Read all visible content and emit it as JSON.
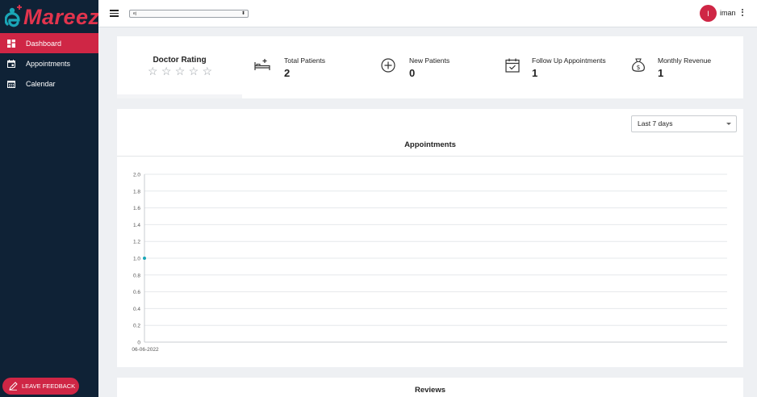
{
  "brand": {
    "name": "Mareez",
    "accent": "#cf2645",
    "sidebar_bg": "#0f2236"
  },
  "sidebar": {
    "items": [
      {
        "label": "Dashboard",
        "icon": "dashboard-icon",
        "active": true
      },
      {
        "label": "Appointments",
        "icon": "calendar-event-icon",
        "active": false
      },
      {
        "label": "Calendar",
        "icon": "calendar-grid-icon",
        "active": false
      }
    ],
    "feedback_label": "LEAVE FEEDBACK"
  },
  "topbar": {
    "clinic_value": "ej",
    "user_initial": "I",
    "user_name": "iman"
  },
  "stats": {
    "rating_title": "Doctor Rating",
    "stars": [
      "☆",
      "☆",
      "☆",
      "☆",
      "☆"
    ],
    "total_patients": {
      "label": "Total Patients",
      "value": "2",
      "icon": "bed-icon"
    },
    "new_patients": {
      "label": "New Patients",
      "value": "0",
      "icon": "plus-circle-icon"
    },
    "follow_up": {
      "label": "Follow Up Appointments",
      "value": "1",
      "icon": "calendar-check-icon"
    },
    "monthly_revenue": {
      "label": "Monthly Revenue",
      "value": "1",
      "icon": "money-bag-icon"
    }
  },
  "chart": {
    "range_value": "Last 7 days",
    "title": "Appointments"
  },
  "chart_data": {
    "type": "line",
    "title": "Appointments",
    "x": [
      "06-06-2022"
    ],
    "series": [
      {
        "values": [
          1
        ]
      }
    ],
    "ylim": [
      0,
      2.0
    ],
    "yticks": [
      "0",
      "0.2",
      "0.4",
      "0.6",
      "0.8",
      "1.0",
      "1.2",
      "1.4",
      "1.6",
      "1.8",
      "2.0"
    ],
    "grid": true,
    "color": "#1aa6b7"
  },
  "reviews": {
    "title": "Reviews"
  }
}
